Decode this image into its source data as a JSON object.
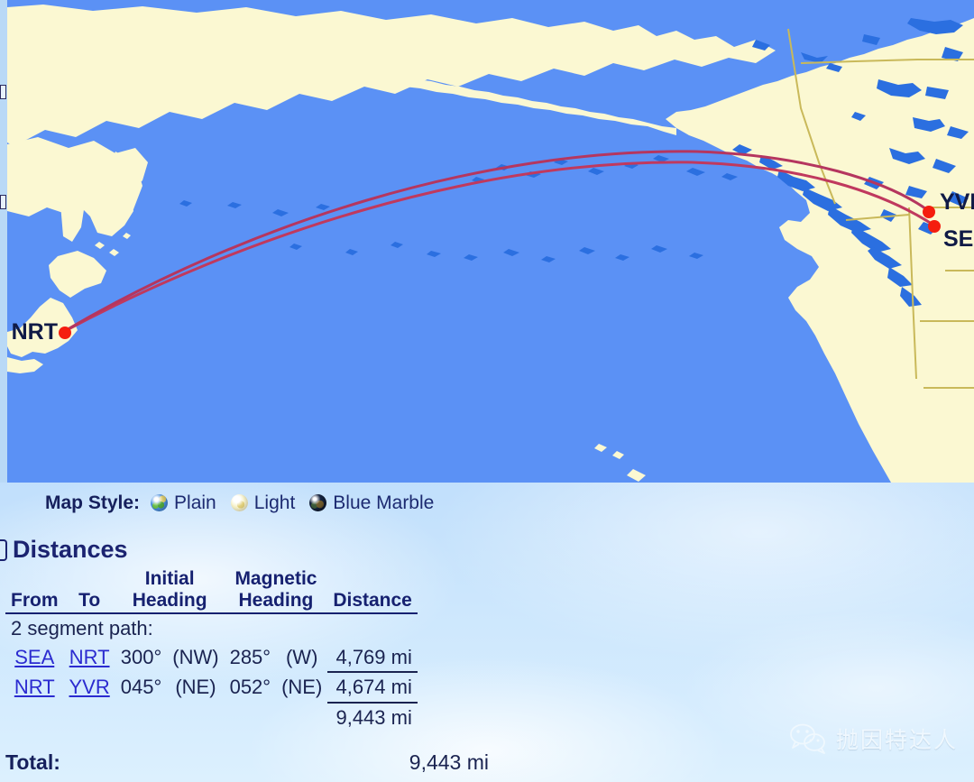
{
  "map": {
    "style_label": "Map Style:",
    "styles": [
      {
        "icon": "globe-plain-icon",
        "label": "Plain"
      },
      {
        "icon": "globe-light-icon",
        "label": "Light"
      },
      {
        "icon": "globe-blue-marble-icon",
        "label": "Blue Marble"
      }
    ],
    "markers": [
      {
        "code": "NRT"
      },
      {
        "code": "YVR"
      },
      {
        "code": "SEA"
      }
    ],
    "colors": {
      "ocean": "#5b91f5",
      "land": "#fbf8d2",
      "route": "#c0395e",
      "marker": "#f51d0e",
      "border": "#c9b95a"
    }
  },
  "distances": {
    "heading": "Distances",
    "columns": {
      "from": "From",
      "to": "To",
      "initial_heading_l1": "Initial",
      "initial_heading_l2": "Heading",
      "magnetic_heading_l1": "Magnetic",
      "magnetic_heading_l2": "Heading",
      "distance": "Distance"
    },
    "segment_note": "2 segment path:",
    "rows": [
      {
        "from": "SEA",
        "to": "NRT",
        "initial_deg": "300°",
        "initial_dir": "(NW)",
        "magnetic_deg": "285°",
        "magnetic_dir": "(W)",
        "distance": "4,769 mi"
      },
      {
        "from": "NRT",
        "to": "YVR",
        "initial_deg": "045°",
        "initial_dir": "(NE)",
        "magnetic_deg": "052°",
        "magnetic_dir": "(NE)",
        "distance": "4,674 mi"
      }
    ],
    "subtotal": "9,443 mi",
    "total_label": "Total:",
    "total_value": "9,443 mi"
  },
  "watermark": {
    "icon": "wechat-icon",
    "text": "抛因特达人"
  }
}
